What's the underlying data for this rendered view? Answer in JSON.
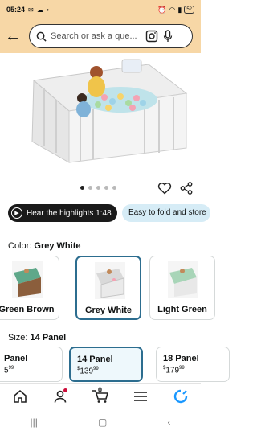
{
  "status_bar": {
    "time": "05:24",
    "battery": "52"
  },
  "search": {
    "placeholder": "Search or ask a que..."
  },
  "gallery": {
    "dot_count": 5,
    "active_index": 0
  },
  "highlights": {
    "label": "Hear the highlights 1:48"
  },
  "feature_pill": {
    "label": "Easy to fold and store"
  },
  "color": {
    "label": "Color:",
    "selected": "Grey White",
    "options": [
      {
        "name": "Green Brown",
        "thumb_color": "#5fa88a"
      },
      {
        "name": "Grey White",
        "thumb_color": "#d9d9d9"
      },
      {
        "name": "Light Green",
        "thumb_color": "#a8d5b8"
      }
    ]
  },
  "size": {
    "label": "Size:",
    "selected": "14 Panel",
    "options": [
      {
        "name": "Panel",
        "price_whole": "5",
        "price_frac": "99"
      },
      {
        "name": "14 Panel",
        "price_symbol": "$",
        "price_whole": "139",
        "price_frac": "99"
      },
      {
        "name": "18 Panel",
        "price_symbol": "$",
        "price_whole": "179",
        "price_frac": "99"
      }
    ]
  },
  "cart": {
    "count": "0"
  },
  "colors": {
    "accent": "#2c6d8f",
    "header_bg": "#f7d7a6",
    "dark_pill": "#1a1a1a",
    "blue_pill": "#d6ecf6"
  }
}
